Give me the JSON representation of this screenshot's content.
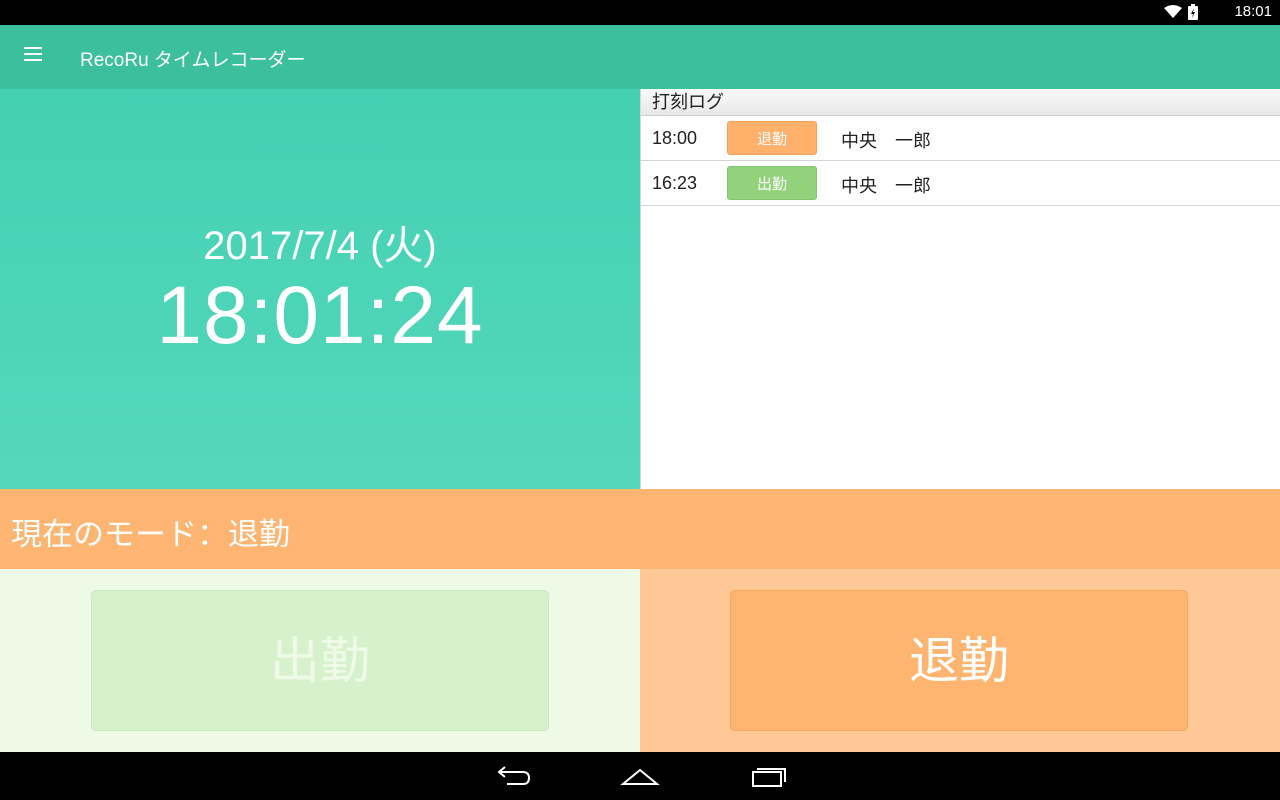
{
  "statusbar": {
    "clock": "18:01"
  },
  "appbar": {
    "title": "RecoRu タイムレコーダー"
  },
  "clock": {
    "date": "2017/7/4 (火)",
    "time": "18:01:24"
  },
  "log": {
    "header": "打刻ログ",
    "rows": [
      {
        "time": "18:00",
        "type": "退勤",
        "name": "中央　一郎"
      },
      {
        "time": "16:23",
        "type": "出勤",
        "name": "中央　一郎"
      }
    ]
  },
  "mode": {
    "label": "現在のモード：退勤"
  },
  "buttons": {
    "clock_in": "出勤",
    "clock_out": "退勤"
  },
  "colors": {
    "appbar": "#3cbf9c",
    "clock_bg": "#48d3b5",
    "mode_bg": "#ffb572",
    "badge_out": "#ffb06b",
    "badge_in": "#92d27b"
  }
}
